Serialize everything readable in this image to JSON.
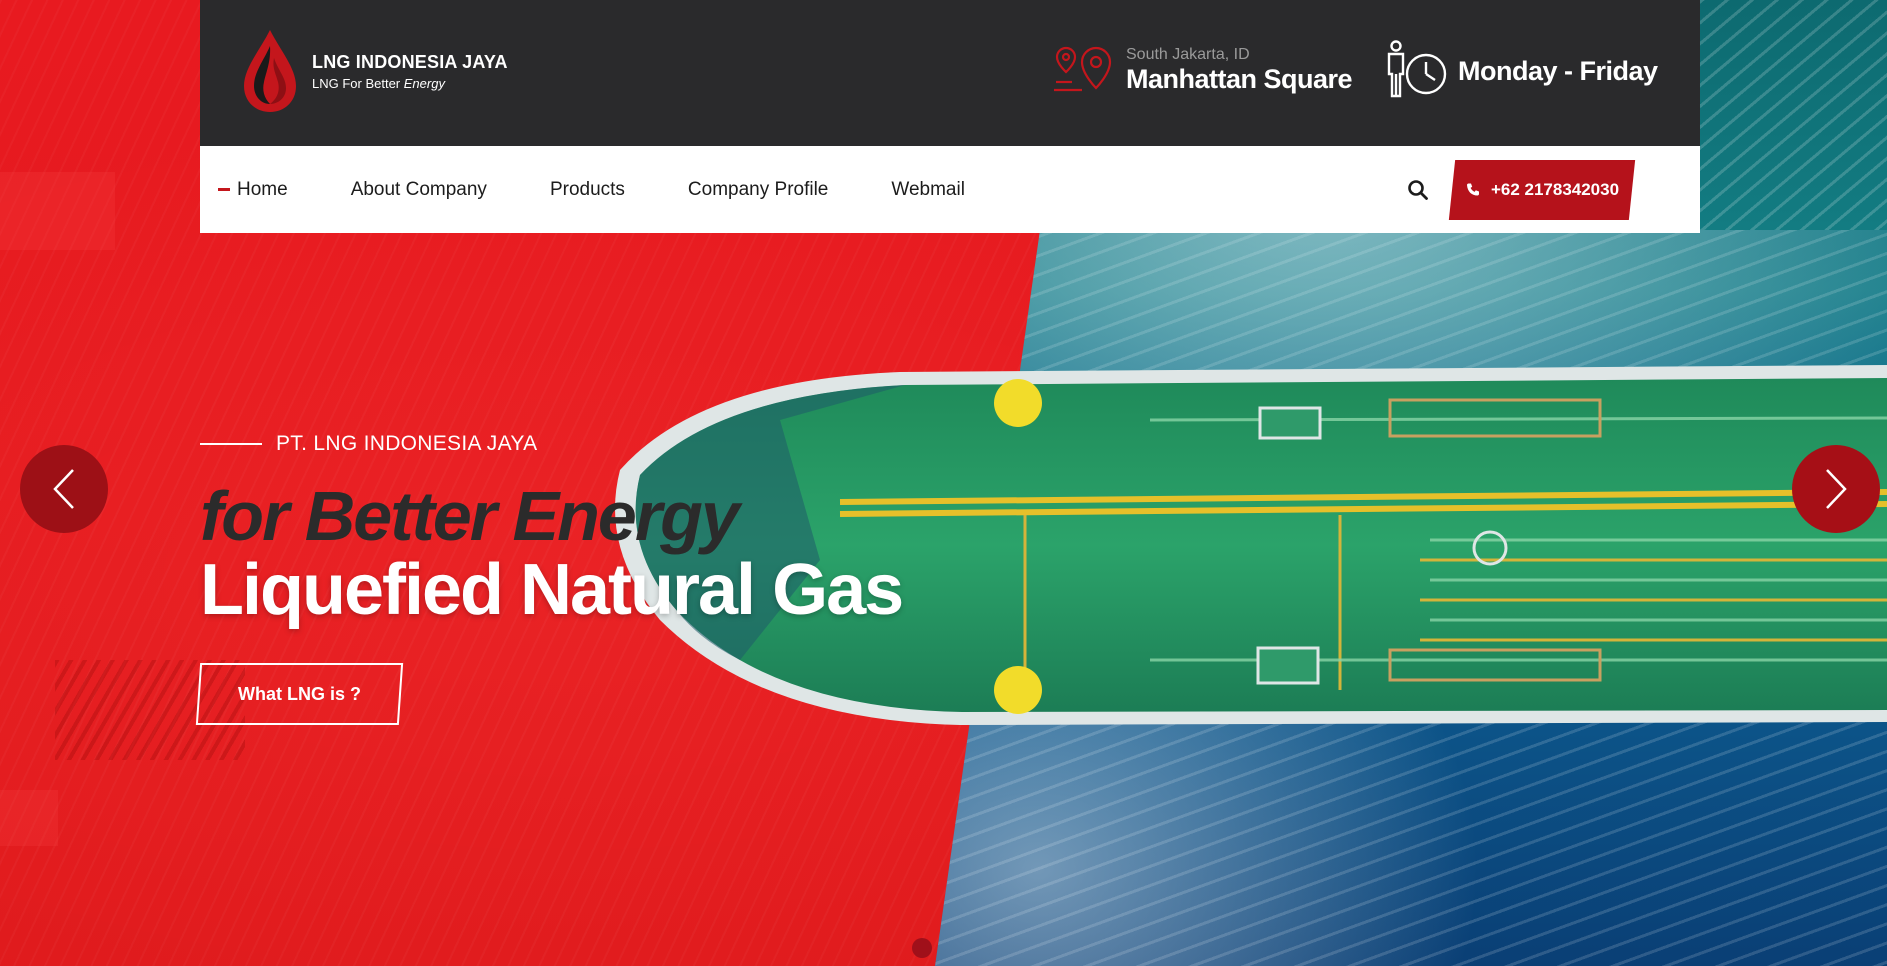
{
  "brand": {
    "name": "LNG INDONESIA JAYA",
    "tagline_prefix": "LNG For Better ",
    "tagline_emphasis": "Energy"
  },
  "header": {
    "location_small": "South Jakarta, ID",
    "location_big": "Manhattan Square",
    "hours": "Monday - Friday"
  },
  "nav": {
    "items": [
      "Home",
      "About Company",
      "Products",
      "Company Profile",
      "Webmail"
    ],
    "active": "Home",
    "phone": "+62 2178342030"
  },
  "hero": {
    "eyebrow": "PT. LNG INDONESIA JAYA",
    "subtitle": "for Better Energy",
    "title": "Liquefied Natural Gas",
    "cta": "What LNG is ?"
  },
  "icons": {
    "location": "location-pin-icon",
    "hours": "person-clock-icon",
    "search": "search-icon",
    "phone": "phone-icon",
    "prev": "chevron-left-icon",
    "next": "chevron-right-icon"
  },
  "colors": {
    "accent_red": "#c4161c",
    "hero_red": "#e41a1e",
    "header_dark": "#2a2a2c",
    "arrow_red": "#9d1016"
  },
  "slider": {
    "current_slide": 1
  }
}
